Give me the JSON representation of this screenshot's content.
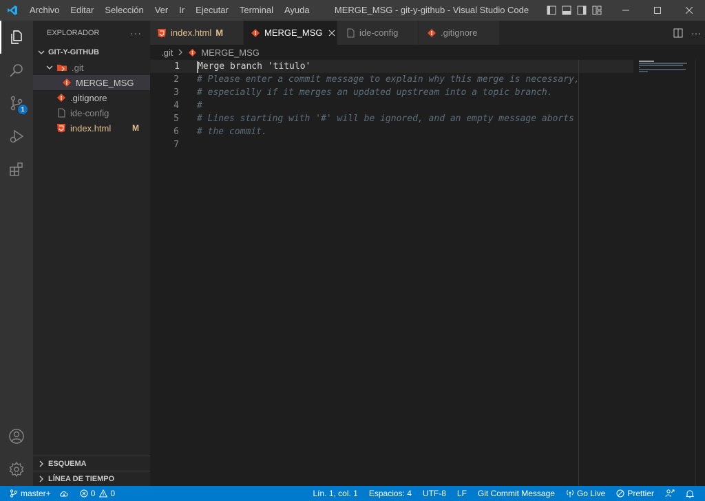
{
  "titlebar": {
    "menu": [
      "Archivo",
      "Editar",
      "Selección",
      "Ver",
      "Ir",
      "Ejecutar",
      "Terminal",
      "Ayuda"
    ],
    "title": "MERGE_MSG - git-y-github - Visual Studio Code"
  },
  "activitybar": {
    "scm_badge": "1"
  },
  "sidebar": {
    "header": "EXPLORADOR",
    "more": "···",
    "root": "GIT-Y-GITHUB",
    "tree": [
      {
        "label": ".git",
        "badge": ""
      },
      {
        "label": "MERGE_MSG",
        "badge": ""
      },
      {
        "label": ".gitignore",
        "badge": ""
      },
      {
        "label": "ide-config",
        "badge": ""
      },
      {
        "label": "index.html",
        "badge": "M"
      }
    ],
    "outline": "ESQUEMA",
    "timeline": "LÍNEA DE TIEMPO"
  },
  "tabs": [
    {
      "label": "index.html",
      "mod": "M"
    },
    {
      "label": "MERGE_MSG",
      "mod": ""
    },
    {
      "label": "ide-config",
      "mod": ""
    },
    {
      "label": ".gitignore",
      "mod": ""
    }
  ],
  "breadcrumb": {
    "folder": ".git",
    "file": "MERGE_MSG"
  },
  "editor": {
    "lines": [
      {
        "num": "1",
        "text": "Merge branch 'titulo'"
      },
      {
        "num": "2",
        "text": "# Please enter a commit message to explain why this merge is necessary,"
      },
      {
        "num": "3",
        "text": "# especially if it merges an updated upstream into a topic branch."
      },
      {
        "num": "4",
        "text": "#"
      },
      {
        "num": "5",
        "text": "# Lines starting with '#' will be ignored, and an empty message aborts"
      },
      {
        "num": "6",
        "text": "# the commit."
      },
      {
        "num": "7",
        "text": ""
      }
    ]
  },
  "statusbar": {
    "branch": "master+",
    "errors": "0",
    "warnings": "0",
    "position": "Lín. 1, col. 1",
    "spaces": "Espacios: 4",
    "encoding": "UTF-8",
    "eol": "LF",
    "language": "Git Commit Message",
    "golive": "Go Live",
    "prettier": "Prettier"
  },
  "colors": {
    "statusbar": "#007acc",
    "git_icon": "#e44d26",
    "html_icon": "#e44d26",
    "modified": "#e2c08d"
  }
}
